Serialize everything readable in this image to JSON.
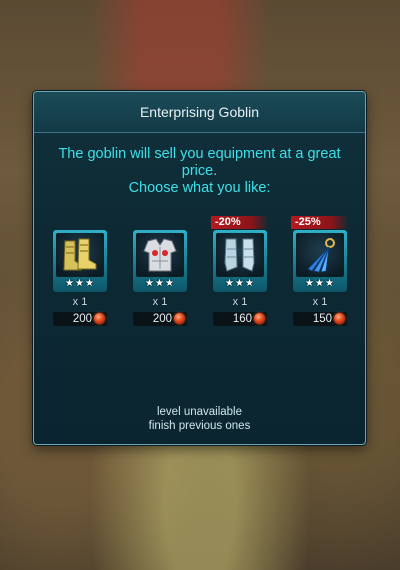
{
  "modal": {
    "title": "Enterprising Goblin",
    "description_line1": "The goblin will sell you equipment at a great",
    "description_line2": "price.",
    "description_line3": "Choose what you like:",
    "footer_line1": "level unavailable",
    "footer_line2": "finish previous ones"
  },
  "items": [
    {
      "icon": "golden-boots-icon",
      "stars": "★★★",
      "quantity": "x 1",
      "price": "200",
      "discount": ""
    },
    {
      "icon": "silver-chest-armor-icon",
      "stars": "★★★",
      "quantity": "x 1",
      "price": "200",
      "discount": ""
    },
    {
      "icon": "steel-greaves-icon",
      "stars": "★★★",
      "quantity": "x 1",
      "price": "160",
      "discount": "-20%"
    },
    {
      "icon": "feathered-amulet-icon",
      "stars": "★★★",
      "quantity": "x 1",
      "price": "150",
      "discount": "-25%"
    }
  ],
  "colors": {
    "accent_text": "#3de0e8",
    "card_teal": "#1a7d93",
    "discount_red": "#b4191f",
    "currency_gem": "#e2461c"
  }
}
